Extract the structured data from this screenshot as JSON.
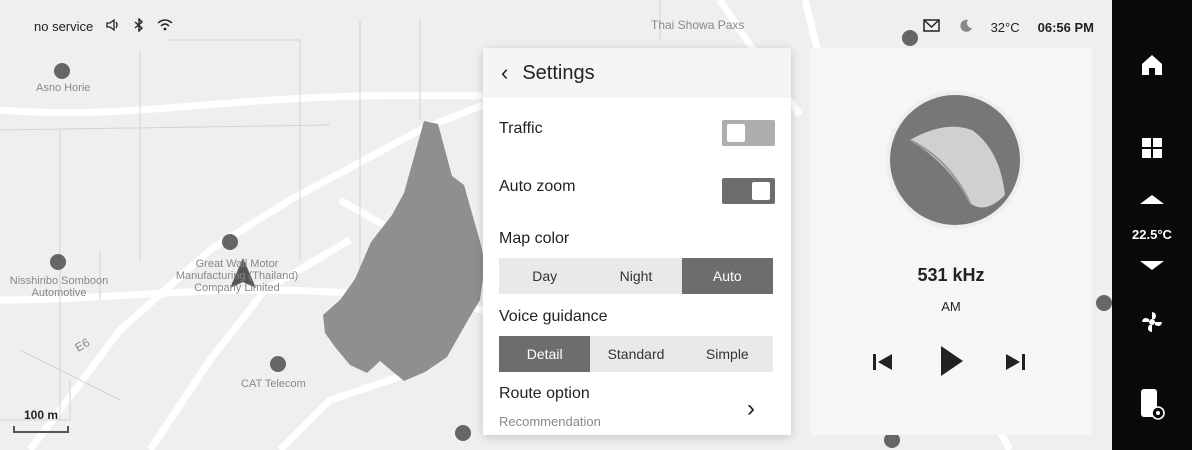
{
  "status": {
    "network": "no service",
    "temperature": "32°C",
    "time": "06:56 PM"
  },
  "map": {
    "places": [
      "Thai Showa Paxs",
      "Asno Horie",
      "Great Wall Motor\nManufacturing (Thailand)\nCompany Limited",
      "Nisshinbo Somboon\nAutomotive",
      "CAT Telecom",
      "E6"
    ],
    "scale": "100 m"
  },
  "settings": {
    "title": "Settings",
    "traffic": {
      "label": "Traffic",
      "enabled": false
    },
    "auto_zoom": {
      "label": "Auto zoom",
      "enabled": true
    },
    "map_color": {
      "label": "Map color",
      "options": [
        "Day",
        "Night",
        "Auto"
      ],
      "selected": "Auto"
    },
    "voice_guidance": {
      "label": "Voice guidance",
      "options": [
        "Detail",
        "Standard",
        "Simple"
      ],
      "selected": "Detail"
    },
    "route_option": {
      "label": "Route option",
      "value": "Recommendation"
    }
  },
  "media": {
    "frequency": "531 kHz",
    "band": "AM"
  },
  "sidebar": {
    "climate_temp": "22.5°C"
  }
}
